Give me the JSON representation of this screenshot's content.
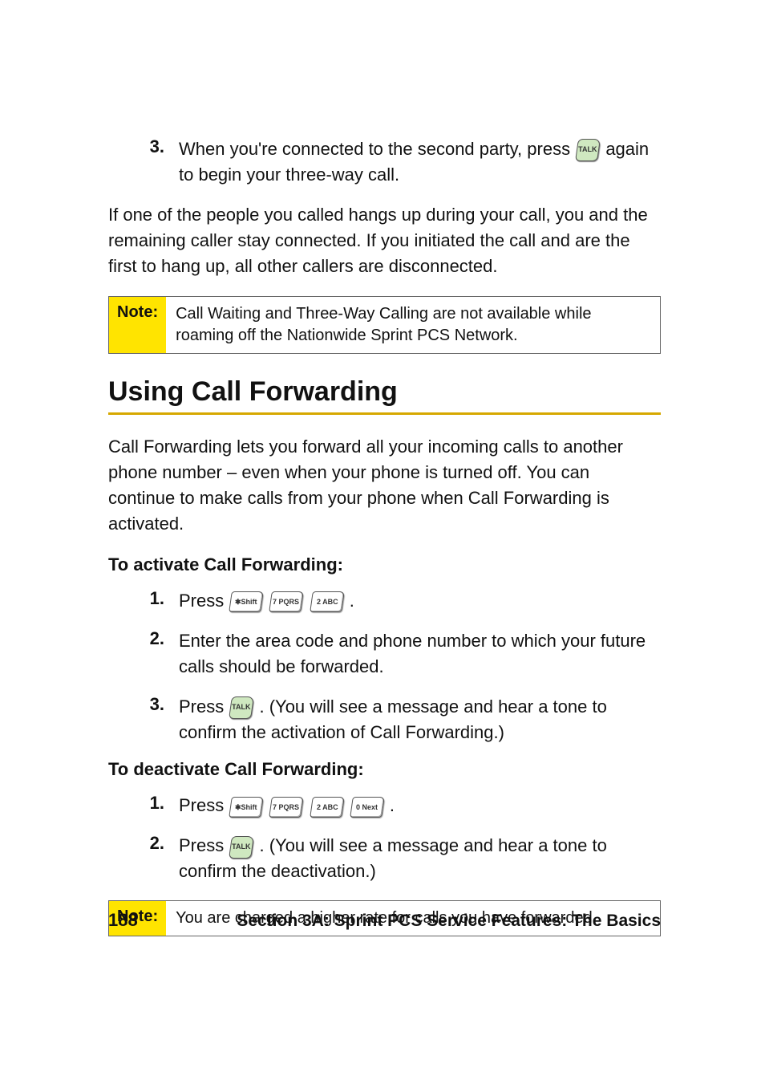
{
  "intro_list": {
    "item3_num": "3.",
    "item3_text_a": "When you're connected to the second party, press ",
    "item3_text_b": " again to begin your three-way call."
  },
  "intro_para": "If one of the people you called hangs up during your call, you and the remaining caller stay connected. If you initiated the call and are the first to hang up, all other callers are disconnected.",
  "note1": {
    "label": "Note:",
    "text": "Call Waiting and Three-Way Calling are not available while roaming off the Nationwide Sprint PCS Network."
  },
  "heading": "Using Call Forwarding",
  "body_para": "Call Forwarding lets you forward all your incoming calls to another phone number – even when your phone is turned off. You can continue to make calls from your phone when Call Forwarding is activated.",
  "activate": {
    "head": "To activate Call Forwarding:",
    "s1_num": "1.",
    "s1_a": "Press ",
    "s1_b": ".",
    "s2_num": "2.",
    "s2": "Enter the area code and phone number to which your future calls should be forwarded.",
    "s3_num": "3.",
    "s3_a": "Press ",
    "s3_b": ". (You will see a message and hear a tone to confirm the activation of Call Forwarding.)"
  },
  "deactivate": {
    "head": "To deactivate Call Forwarding:",
    "s1_num": "1.",
    "s1_a": "Press ",
    "s1_b": ".",
    "s2_num": "2.",
    "s2_a": "Press ",
    "s2_b": ". (You will see a message and hear a tone to confirm the deactivation.)"
  },
  "note2": {
    "label": "Note:",
    "text": "You are charged a higher rate for calls you have forwarded."
  },
  "footer": {
    "page": "188",
    "title": "Section 3A: Sprint PCS Service Features: The Basics"
  },
  "keys": {
    "star": "✱Shift",
    "seven": "7 PQRS",
    "two": "2 ABC",
    "zero": "0 Next",
    "talk": "TALK"
  }
}
